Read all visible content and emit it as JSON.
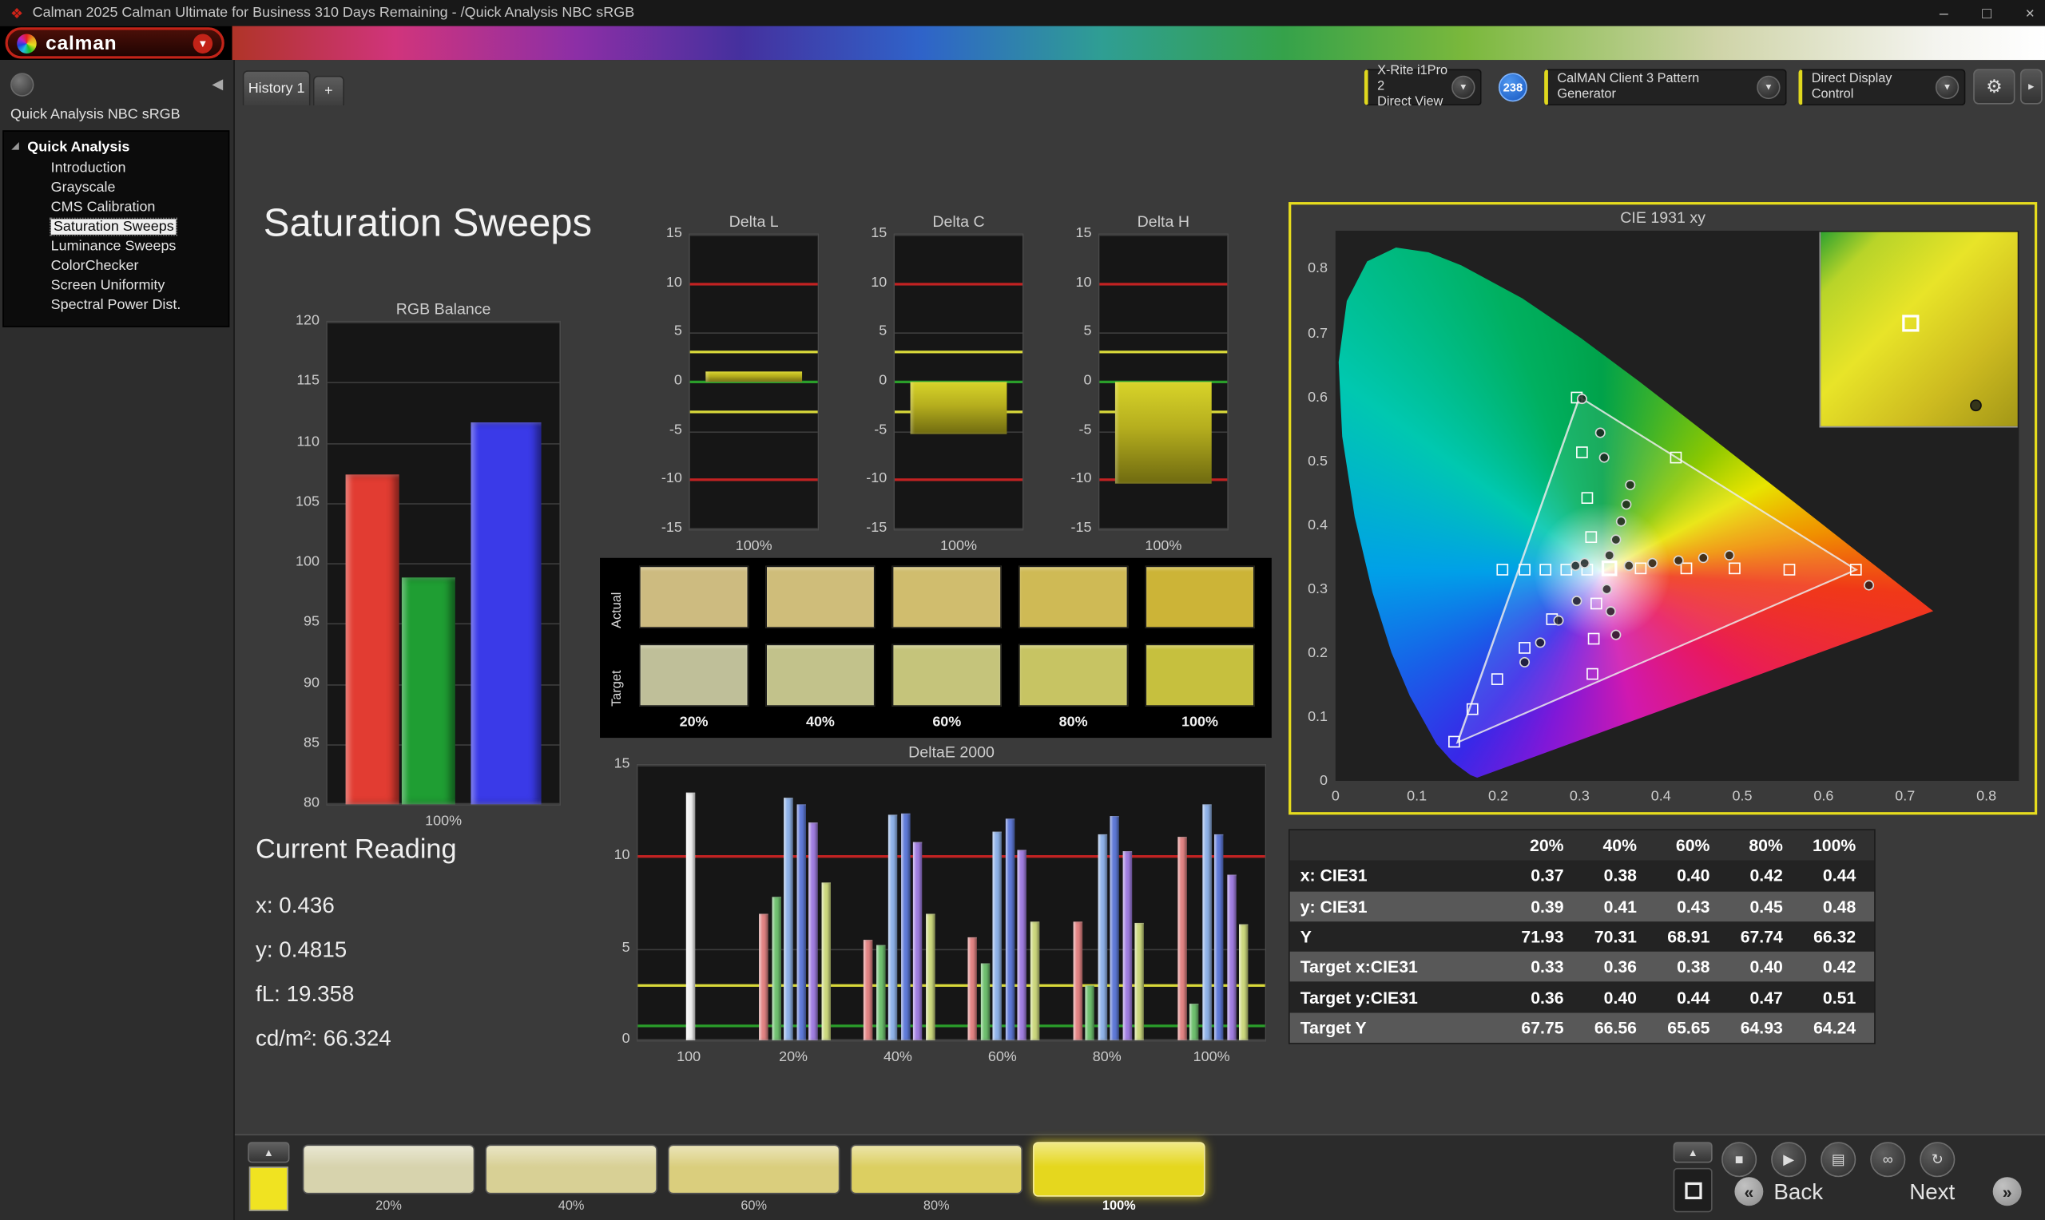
{
  "window": {
    "title": "Calman 2025 Calman Ultimate for Business 310 Days Remaining  - /Quick Analysis NBC sRGB",
    "controls": {
      "minimize": "–",
      "maximize": "□",
      "close": "×"
    }
  },
  "logo": {
    "brand": "calman"
  },
  "tabs": {
    "history": "History 1",
    "add": "+"
  },
  "meter": {
    "line1": "X-Rite i1Pro 2",
    "line2": "Direct View",
    "badge": "238"
  },
  "pattern_generator": {
    "label": "CalMAN Client 3 Pattern Generator"
  },
  "display_control": {
    "label": "Direct Display Control"
  },
  "sidebar": {
    "title": "Quick Analysis NBC sRGB",
    "root": "Quick Analysis",
    "items": [
      "Introduction",
      "Grayscale",
      "CMS Calibration",
      "Saturation Sweeps",
      "Luminance Sweeps",
      "ColorChecker",
      "Screen Uniformity",
      "Spectral Power Dist."
    ],
    "selected": "Saturation Sweeps"
  },
  "page": {
    "title": "Saturation Sweeps"
  },
  "current_reading": {
    "title": "Current Reading",
    "lines": [
      "x: 0.436",
      "y: 0.4815",
      "fL: 19.358",
      "cd/m²: 66.324"
    ]
  },
  "swatch_grid": {
    "row_labels": [
      "Actual",
      "Target"
    ],
    "col_labels": [
      "20%",
      "40%",
      "60%",
      "80%",
      "100%"
    ],
    "actual_colors": [
      "#cdbb80",
      "#cfbd7a",
      "#d0bd6e",
      "#cfba55",
      "#ccb437"
    ],
    "target_colors": [
      "#bfbf99",
      "#c2c28b",
      "#c5c47b",
      "#c7c463",
      "#c6c03e"
    ]
  },
  "table": {
    "columns": [
      "20%",
      "40%",
      "60%",
      "80%",
      "100%"
    ],
    "rows": [
      {
        "label": "x: CIE31",
        "values": [
          "0.37",
          "0.38",
          "0.40",
          "0.42",
          "0.44"
        ]
      },
      {
        "label": "y: CIE31",
        "values": [
          "0.39",
          "0.41",
          "0.43",
          "0.45",
          "0.48"
        ]
      },
      {
        "label": "Y",
        "values": [
          "71.93",
          "70.31",
          "68.91",
          "67.74",
          "66.32"
        ]
      },
      {
        "label": "Target x:CIE31",
        "values": [
          "0.33",
          "0.36",
          "0.38",
          "0.40",
          "0.42"
        ]
      },
      {
        "label": "Target y:CIE31",
        "values": [
          "0.36",
          "0.40",
          "0.44",
          "0.47",
          "0.51"
        ]
      },
      {
        "label": "Target Y",
        "values": [
          "67.75",
          "66.56",
          "65.65",
          "64.93",
          "64.24"
        ]
      }
    ]
  },
  "bottom_bar": {
    "swatches": [
      {
        "label": "20%",
        "color": "#d7d3ad"
      },
      {
        "label": "40%",
        "color": "#d8d095"
      },
      {
        "label": "60%",
        "color": "#dace7d"
      },
      {
        "label": "80%",
        "color": "#dccf61"
      },
      {
        "label": "100%",
        "color": "#e5d71e"
      }
    ],
    "active_index": 4,
    "preview_color": "#f0e321"
  },
  "transport": {
    "buttons": [
      {
        "name": "stop",
        "glyph": "■"
      },
      {
        "name": "play",
        "glyph": "▶"
      },
      {
        "name": "save",
        "glyph": "▤"
      },
      {
        "name": "session",
        "glyph": "∞"
      },
      {
        "name": "refresh",
        "glyph": "↻"
      }
    ],
    "back_label": "Back",
    "next_label": "Next",
    "back_chevron": "«",
    "next_chevron": "»"
  },
  "chart_data": [
    {
      "id": "rgb_balance",
      "type": "bar",
      "title": "RGB Balance",
      "categories": [
        "Red",
        "Green",
        "Blue"
      ],
      "values": [
        107.3,
        98.8,
        111.7
      ],
      "colors": [
        "#e23c32",
        "#1f9e33",
        "#3a3ae8"
      ],
      "bar_pos": [
        [
          0.08,
          0.31
        ],
        [
          0.32,
          0.55
        ],
        [
          0.62,
          0.92
        ]
      ],
      "ylim": [
        80,
        120
      ],
      "yticks": [
        120,
        115,
        110,
        105,
        100,
        95,
        90,
        85,
        80
      ],
      "xlabel": "100%"
    },
    {
      "id": "delta_l",
      "type": "bar",
      "title": "Delta L",
      "categories": [
        "100%"
      ],
      "values": [
        1.0
      ],
      "ylim": [
        -15,
        15
      ],
      "yticks": [
        15,
        10,
        5,
        0,
        -5,
        -10,
        -15
      ],
      "ref_lines": [
        {
          "y": 10,
          "color": "#c22222"
        },
        {
          "y": -10,
          "color": "#c22222"
        },
        {
          "y": 3,
          "color": "#d8d83a"
        },
        {
          "y": -3,
          "color": "#d8d83a"
        },
        {
          "y": 0,
          "color": "#2a9e2a"
        }
      ],
      "xlabel": "100%"
    },
    {
      "id": "delta_c",
      "type": "bar",
      "title": "Delta C",
      "categories": [
        "100%"
      ],
      "values": [
        -5.3
      ],
      "ylim": [
        -15,
        15
      ],
      "yticks": [
        15,
        10,
        5,
        0,
        -5,
        -10,
        -15
      ],
      "ref_lines": [
        {
          "y": 10,
          "color": "#c22222"
        },
        {
          "y": -10,
          "color": "#c22222"
        },
        {
          "y": 3,
          "color": "#d8d83a"
        },
        {
          "y": -3,
          "color": "#d8d83a"
        },
        {
          "y": 0,
          "color": "#2a9e2a"
        }
      ],
      "xlabel": "100%"
    },
    {
      "id": "delta_h",
      "type": "bar",
      "title": "Delta H",
      "categories": [
        "100%"
      ],
      "values": [
        -10.3
      ],
      "ylim": [
        -15,
        15
      ],
      "yticks": [
        15,
        10,
        5,
        0,
        -5,
        -10,
        -15
      ],
      "ref_lines": [
        {
          "y": 10,
          "color": "#c22222"
        },
        {
          "y": -10,
          "color": "#c22222"
        },
        {
          "y": 3,
          "color": "#d8d83a"
        },
        {
          "y": -3,
          "color": "#d8d83a"
        },
        {
          "y": 0,
          "color": "#2a9e2a"
        }
      ],
      "xlabel": "100%"
    },
    {
      "id": "deltae_2000",
      "type": "grouped_bar",
      "title": "DeltaE 2000",
      "ylim": [
        0,
        15
      ],
      "yticks": [
        15,
        10,
        5,
        0
      ],
      "ref_lines": [
        {
          "y": 10,
          "color": "#c22222"
        },
        {
          "y": 3,
          "color": "#d8d83a"
        },
        {
          "y": 0.8,
          "color": "#2a9e2a"
        }
      ],
      "groups": [
        {
          "label": "100",
          "values": [
            13.5
          ],
          "colors": [
            "#f0f0f0"
          ]
        },
        {
          "label": "20%",
          "values": [
            6.9,
            7.8,
            13.2,
            12.9,
            11.9,
            8.6
          ],
          "colors": [
            "#e28484",
            "#6fc06f",
            "#8fb2e8",
            "#5f7ad8",
            "#a07ee0",
            "#ccd87e"
          ]
        },
        {
          "label": "40%",
          "values": [
            5.5,
            5.2,
            12.3,
            12.4,
            10.8,
            6.9
          ],
          "colors": [
            "#e28484",
            "#6fc06f",
            "#8fb2e8",
            "#5f7ad8",
            "#a07ee0",
            "#ccd87e"
          ]
        },
        {
          "label": "60%",
          "values": [
            5.6,
            4.2,
            11.4,
            12.1,
            10.4,
            6.5
          ],
          "colors": [
            "#e28484",
            "#6fc06f",
            "#8fb2e8",
            "#5f7ad8",
            "#a07ee0",
            "#ccd87e"
          ]
        },
        {
          "label": "80%",
          "values": [
            6.5,
            3.0,
            11.2,
            12.2,
            10.3,
            6.4
          ],
          "colors": [
            "#e28484",
            "#6fc06f",
            "#8fb2e8",
            "#5f7ad8",
            "#a07ee0",
            "#ccd87e"
          ]
        },
        {
          "label": "100%",
          "values": [
            11.1,
            2.0,
            12.9,
            11.2,
            9.0,
            6.3
          ],
          "colors": [
            "#e28484",
            "#6fc06f",
            "#8fb2e8",
            "#5f7ad8",
            "#a07ee0",
            "#ccd87e"
          ]
        }
      ]
    },
    {
      "id": "cie1931",
      "type": "scatter",
      "title": "CIE 1931 xy",
      "xlim": [
        0,
        0.8
      ],
      "ylim": [
        0,
        0.8
      ],
      "ticks": [
        0,
        0.1,
        0.2,
        0.3,
        0.4,
        0.5,
        0.6,
        0.7,
        0.8
      ],
      "gamut_triangle": [
        [
          0.64,
          0.33
        ],
        [
          0.3,
          0.6
        ],
        [
          0.15,
          0.06
        ]
      ],
      "current": [
        0.336,
        0.333
      ],
      "targets": [
        [
          0.205,
          0.33
        ],
        [
          0.232,
          0.33
        ],
        [
          0.258,
          0.33
        ],
        [
          0.284,
          0.331
        ],
        [
          0.31,
          0.331
        ],
        [
          0.375,
          0.332
        ],
        [
          0.432,
          0.333
        ],
        [
          0.49,
          0.332
        ],
        [
          0.558,
          0.331
        ],
        [
          0.64,
          0.33
        ],
        [
          0.314,
          0.382
        ],
        [
          0.309,
          0.443
        ],
        [
          0.303,
          0.513
        ],
        [
          0.297,
          0.6
        ],
        [
          0.321,
          0.278
        ],
        [
          0.318,
          0.222
        ],
        [
          0.316,
          0.168
        ],
        [
          0.266,
          0.252
        ],
        [
          0.232,
          0.208
        ],
        [
          0.198,
          0.158
        ],
        [
          0.168,
          0.112
        ],
        [
          0.146,
          0.062
        ],
        [
          0.418,
          0.505
        ]
      ],
      "measurements": [
        [
          0.336,
          0.352
        ],
        [
          0.344,
          0.378
        ],
        [
          0.351,
          0.405
        ],
        [
          0.357,
          0.432
        ],
        [
          0.363,
          0.462
        ],
        [
          0.33,
          0.505
        ],
        [
          0.325,
          0.545
        ],
        [
          0.303,
          0.598
        ],
        [
          0.36,
          0.336
        ],
        [
          0.39,
          0.34
        ],
        [
          0.421,
          0.344
        ],
        [
          0.452,
          0.348
        ],
        [
          0.484,
          0.352
        ],
        [
          0.334,
          0.3
        ],
        [
          0.339,
          0.265
        ],
        [
          0.344,
          0.228
        ],
        [
          0.296,
          0.282
        ],
        [
          0.274,
          0.25
        ],
        [
          0.252,
          0.216
        ],
        [
          0.233,
          0.186
        ],
        [
          0.295,
          0.336
        ],
        [
          0.306,
          0.34
        ],
        [
          0.655,
          0.305
        ]
      ]
    }
  ]
}
